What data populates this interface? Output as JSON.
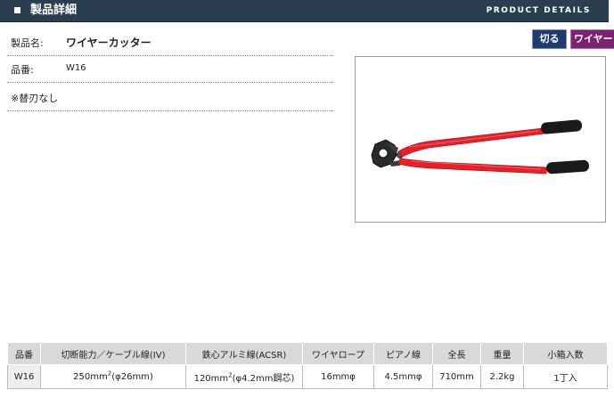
{
  "header": {
    "title": "製品詳細",
    "title_en": "PRODUCT DETAILS"
  },
  "product": {
    "name_label": "製品名:",
    "name_value": "ワイヤーカッター",
    "code_label": "品番:",
    "code_value": "W16",
    "note": "※替刃なし"
  },
  "tags": [
    {
      "label": "切る",
      "color": "#1e3a6e"
    },
    {
      "label": "ワイヤー",
      "color": "#7a2470"
    }
  ],
  "image": {
    "handle_color": "#e8202a",
    "grip_color": "#1a1a1a"
  },
  "spec_table": {
    "headers": [
      "品番",
      "切断能力／ケーブル線(IV)",
      "鉄心アルミ線(ACSR)",
      "ワイヤロープ",
      "ピアノ線",
      "全長",
      "重量",
      "小箱入数"
    ],
    "row": {
      "code": "W16",
      "cable": {
        "pre": "250mm",
        "sup": "2",
        "post": "(φ26mm)"
      },
      "acsr": {
        "pre": "120mm",
        "sup": "2",
        "post": "(φ4.2mm鋼芯)"
      },
      "wire_rope": "16mmφ",
      "piano_wire": "4.5mmφ",
      "length": "710mm",
      "weight": "2.2kg",
      "box_qty": "1丁入"
    }
  }
}
